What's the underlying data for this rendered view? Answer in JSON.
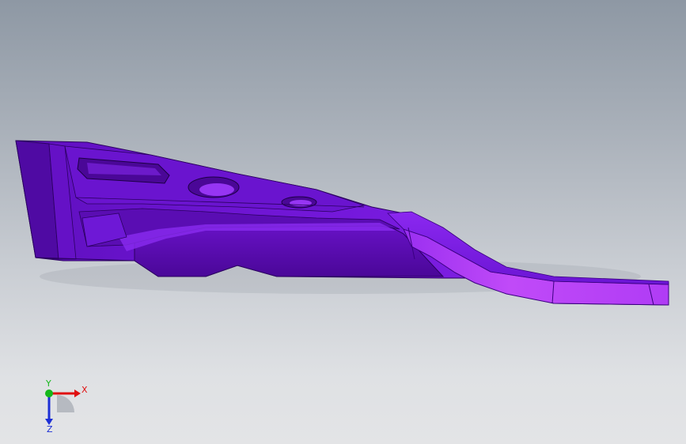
{
  "viewport": {
    "part_color": "#7a1fe6",
    "background_top": "#8e98a4",
    "background_bottom": "#e3e4e6"
  },
  "triad": {
    "x_label": "X",
    "y_label": "Y",
    "z_label": "Z",
    "x_color": "#e01010",
    "y_color": "#16b81c",
    "z_color": "#1d2fd6"
  }
}
